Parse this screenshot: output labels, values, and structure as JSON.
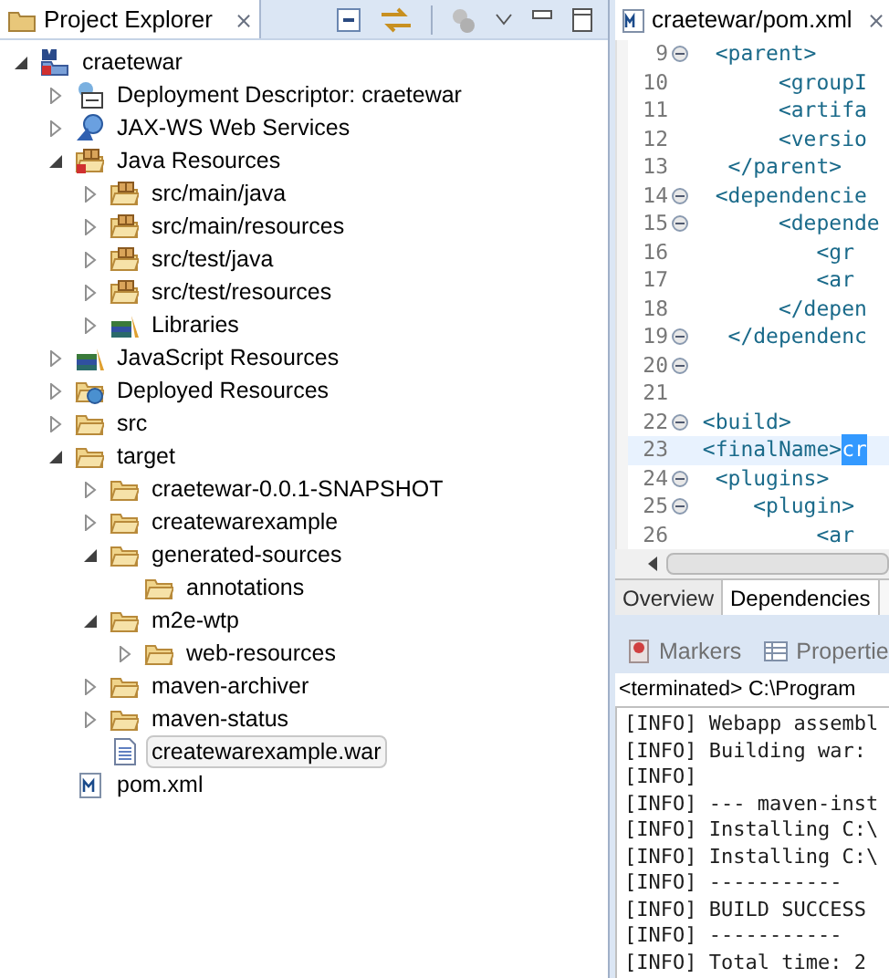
{
  "explorer": {
    "title": "Project Explorer",
    "close": "⨯",
    "tree": [
      {
        "label": "craetewar",
        "kind": "project",
        "expanded": true,
        "selected": false,
        "children": [
          {
            "label": "Deployment Descriptor: craetewar",
            "kind": "descriptor",
            "expanded": false,
            "selected": false
          },
          {
            "label": "JAX-WS Web Services",
            "kind": "webservices",
            "expanded": false,
            "selected": false
          },
          {
            "label": "Java Resources",
            "kind": "java-resources",
            "expanded": true,
            "selected": false,
            "children": [
              {
                "label": "src/main/java",
                "kind": "source-folder",
                "expanded": false,
                "selected": false
              },
              {
                "label": "src/main/resources",
                "kind": "source-folder",
                "expanded": false,
                "selected": false
              },
              {
                "label": "src/test/java",
                "kind": "source-folder",
                "expanded": false,
                "selected": false
              },
              {
                "label": "src/test/resources",
                "kind": "source-folder",
                "expanded": false,
                "selected": false
              },
              {
                "label": "Libraries",
                "kind": "library",
                "expanded": false,
                "selected": false
              }
            ]
          },
          {
            "label": "JavaScript Resources",
            "kind": "library",
            "expanded": false,
            "selected": false
          },
          {
            "label": "Deployed Resources",
            "kind": "deployed",
            "expanded": false,
            "selected": false
          },
          {
            "label": "src",
            "kind": "folder",
            "expanded": false,
            "selected": false
          },
          {
            "label": "target",
            "kind": "folder",
            "expanded": true,
            "selected": false,
            "children": [
              {
                "label": "craetewar-0.0.1-SNAPSHOT",
                "kind": "folder",
                "expanded": false,
                "selected": false
              },
              {
                "label": "createwarexample",
                "kind": "folder",
                "expanded": false,
                "selected": false
              },
              {
                "label": "generated-sources",
                "kind": "folder",
                "expanded": true,
                "selected": false,
                "children": [
                  {
                    "label": "annotations",
                    "kind": "folder",
                    "selected": false
                  }
                ]
              },
              {
                "label": "m2e-wtp",
                "kind": "folder",
                "expanded": true,
                "selected": false,
                "children": [
                  {
                    "label": "web-resources",
                    "kind": "folder",
                    "expanded": false,
                    "selected": false
                  }
                ]
              },
              {
                "label": "maven-archiver",
                "kind": "folder",
                "expanded": false,
                "selected": false
              },
              {
                "label": "maven-status",
                "kind": "folder",
                "expanded": false,
                "selected": false
              },
              {
                "label": "createwarexample.war",
                "kind": "file",
                "selected": true
              }
            ]
          },
          {
            "label": "pom.xml",
            "kind": "pom",
            "selected": false
          }
        ]
      }
    ]
  },
  "editor": {
    "title": "craetewar/pom.xml",
    "close": "⨯",
    "lines": [
      {
        "number": "9",
        "foldable": true,
        "code": "  <parent>"
      },
      {
        "number": "10",
        "foldable": false,
        "code": "       <groupI"
      },
      {
        "number": "11",
        "foldable": false,
        "code": "       <artifa"
      },
      {
        "number": "12",
        "foldable": false,
        "code": "       <versio"
      },
      {
        "number": "13",
        "foldable": false,
        "code": "   </parent>"
      },
      {
        "number": "14",
        "foldable": true,
        "code": "  <dependencie"
      },
      {
        "number": "15",
        "foldable": true,
        "code": "       <depende"
      },
      {
        "number": "16",
        "foldable": false,
        "code": "          <gr"
      },
      {
        "number": "17",
        "foldable": false,
        "code": "          <ar"
      },
      {
        "number": "18",
        "foldable": false,
        "code": "       </depen"
      },
      {
        "number": "19",
        "foldable": true,
        "code": "   </dependenc"
      },
      {
        "number": "20",
        "foldable": true
      },
      {
        "number": "21",
        "foldable": false
      },
      {
        "number": "22",
        "foldable": true,
        "code": " <build>"
      },
      {
        "number": "23",
        "foldable": false,
        "current": true,
        "code": " <finalName>",
        "selection": "cr"
      },
      {
        "number": "24",
        "foldable": true,
        "code": "  <plugins>"
      },
      {
        "number": "25",
        "foldable": true,
        "code": "     <plugin>"
      },
      {
        "number": "26",
        "foldable": false,
        "code": "          <ar"
      }
    ],
    "tabs": [
      {
        "label": "Overview",
        "selected": false
      },
      {
        "label": "Dependencies",
        "selected": true
      }
    ]
  },
  "console": {
    "tabs": [
      {
        "label": "Markers",
        "kind": "markers"
      },
      {
        "label": "Propertie",
        "kind": "properties"
      }
    ],
    "status": "<terminated> C:\\Program",
    "lines": [
      "[INFO] Webapp assembl",
      "[INFO] Building war:",
      "[INFO]",
      "[INFO] --- maven-inst",
      "[INFO] Installing C:\\",
      "[INFO] Installing C:\\",
      "[INFO] -----------",
      "[INFO] BUILD SUCCESS",
      "[INFO] -----------",
      "[INFO] Total time: 2"
    ]
  }
}
